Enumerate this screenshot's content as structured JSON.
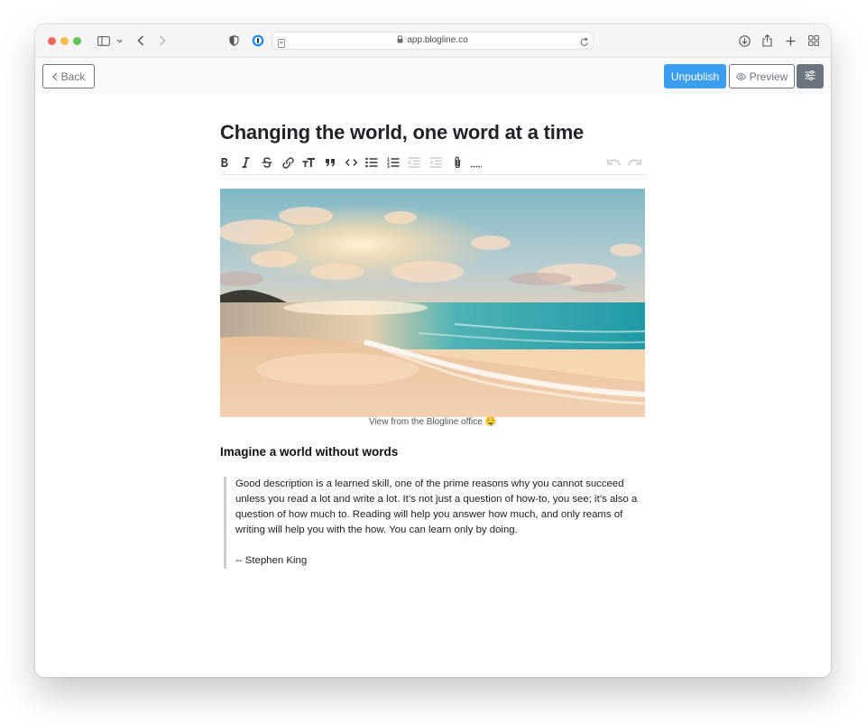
{
  "browser": {
    "url": "app.blogline.co",
    "icons": [
      "sidebar-icon",
      "chevron-down-icon",
      "back-arrow-icon",
      "forward-arrow-icon",
      "shield-icon",
      "password-manager-icon",
      "reader-icon",
      "lock-icon",
      "reload-icon",
      "download-icon",
      "share-icon",
      "new-tab-icon",
      "tab-overview-icon"
    ]
  },
  "header": {
    "back_label": "Back",
    "unpublish_label": "Unpublish",
    "preview_label": "Preview"
  },
  "colors": {
    "accent": "#3b9ef0",
    "secondary": "#6c757d",
    "blockquote_border": "#cfcfcf"
  },
  "editor": {
    "title": "Changing the world, one word at a time",
    "toolbar": [
      {
        "name": "bold-icon",
        "enabled": true
      },
      {
        "name": "italic-icon",
        "enabled": true
      },
      {
        "name": "strikethrough-icon",
        "enabled": true
      },
      {
        "name": "link-icon",
        "enabled": true
      },
      {
        "name": "heading-icon",
        "enabled": true
      },
      {
        "name": "quote-icon",
        "enabled": true
      },
      {
        "name": "code-icon",
        "enabled": true
      },
      {
        "name": "bullet-list-icon",
        "enabled": true
      },
      {
        "name": "numbered-list-icon",
        "enabled": true
      },
      {
        "name": "outdent-icon",
        "enabled": false
      },
      {
        "name": "indent-icon",
        "enabled": false
      },
      {
        "name": "attachment-icon",
        "enabled": true
      },
      {
        "name": "horizontal-rule-icon",
        "enabled": true
      },
      {
        "name": "undo-icon",
        "enabled": false
      },
      {
        "name": "redo-icon",
        "enabled": false
      }
    ],
    "image_caption": "View from the Blogline office 🤤",
    "subheading": "Imagine a world without words",
    "quote": {
      "paragraph": "Good description is a learned skill, one of the prime reasons why you cannot succeed unless you read a lot and write a lot. It’s not just a question of how-to, you see; it’s also a question of how much to. Reading will help you answer how much, and only reams of writing will help you with the how. You can learn only by doing.",
      "attribution": "-- Stephen King"
    }
  }
}
